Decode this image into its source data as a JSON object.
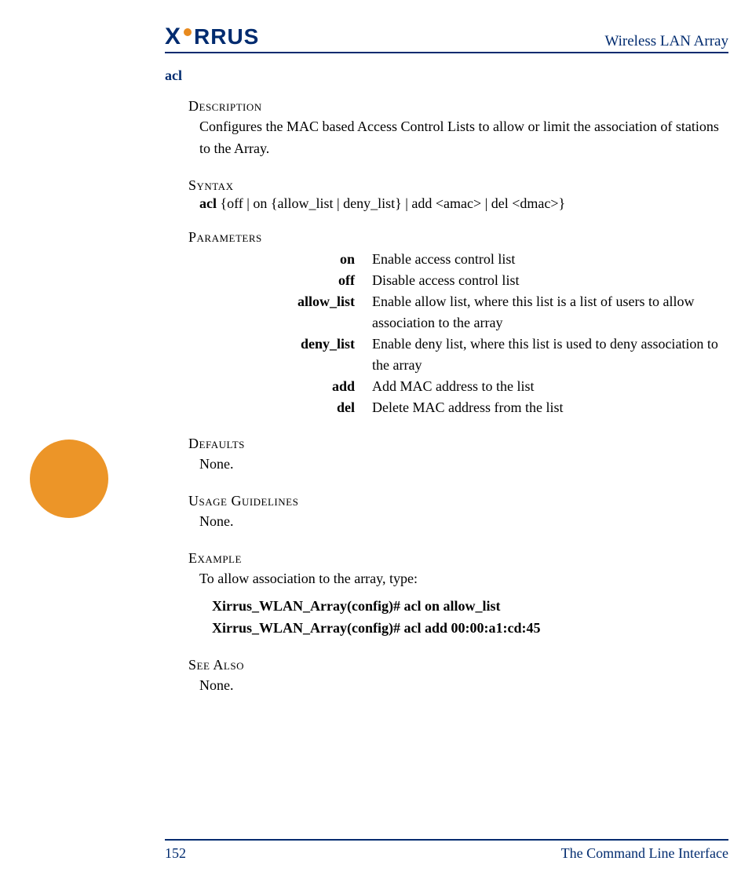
{
  "header": {
    "logo_text": "XIRRUS",
    "title": "Wireless LAN Array"
  },
  "command": {
    "name": "acl"
  },
  "sections": {
    "description": {
      "label": "Description",
      "text": "Configures the MAC based Access Control Lists to allow or limit the association of stations to the Array."
    },
    "syntax": {
      "label": "Syntax",
      "cmd": "acl",
      "rest": " {off | on {allow_list | deny_list} | add <amac> | del <dmac>}"
    },
    "parameters": {
      "label": "Parameters",
      "rows": [
        {
          "name": "on",
          "desc": "Enable access control list"
        },
        {
          "name": "off",
          "desc": "Disable access control list"
        },
        {
          "name": "allow_list",
          "desc": "Enable allow list, where this list is a list of users to allow association to the array"
        },
        {
          "name": "deny_list",
          "desc": "Enable deny list, where this list is used to deny association to the array"
        },
        {
          "name": "add",
          "desc": "Add MAC address to the list"
        },
        {
          "name": "del",
          "desc": "Delete MAC address from the list"
        }
      ]
    },
    "defaults": {
      "label": "Defaults",
      "text": "None."
    },
    "usage": {
      "label": "Usage Guidelines",
      "text": "None."
    },
    "example": {
      "label": "Example",
      "intro": "To allow association to the array, type:",
      "lines": [
        "Xirrus_WLAN_Array(config)# acl on allow_list",
        "Xirrus_WLAN_Array(config)# acl add 00:00:a1:cd:45"
      ]
    },
    "seealso": {
      "label": "See Also",
      "text": "None."
    }
  },
  "footer": {
    "page": "152",
    "chapter": "The Command Line Interface"
  }
}
